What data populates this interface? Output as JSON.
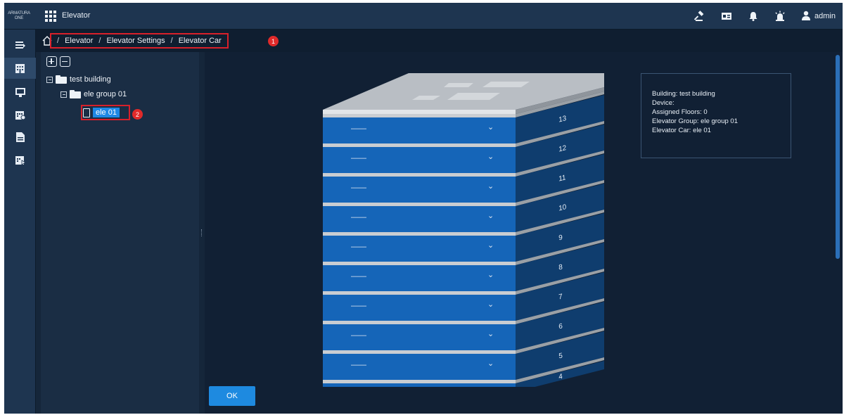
{
  "app": {
    "brand_line1": "ARMATURA",
    "brand_line2": "ONE",
    "title": "Elevator"
  },
  "topbar": {
    "username": "admin",
    "icons": [
      "gavel-icon",
      "id-card-icon",
      "bell-icon",
      "alarm-icon",
      "user-icon"
    ]
  },
  "rail": {
    "items": [
      "list-icon",
      "building-icon",
      "monitor-icon",
      "calendar-icon",
      "file-icon",
      "report-icon"
    ],
    "active_index": 1
  },
  "breadcrumb": {
    "items": [
      "Elevator",
      "Elevator Settings",
      "Elevator Car"
    ],
    "separator": "/",
    "callout": "1"
  },
  "tree": {
    "building": "test building",
    "group": "ele group 01",
    "car": "ele 01",
    "callout": "2"
  },
  "floors": [
    {
      "number": "13",
      "label": "——",
      "chevron": "⌄"
    },
    {
      "number": "12",
      "label": "——",
      "chevron": "⌄"
    },
    {
      "number": "11",
      "label": "——",
      "chevron": "⌄"
    },
    {
      "number": "10",
      "label": "——",
      "chevron": "⌄"
    },
    {
      "number": "9",
      "label": "——",
      "chevron": "⌄"
    },
    {
      "number": "8",
      "label": "——",
      "chevron": "⌄"
    },
    {
      "number": "7",
      "label": "——",
      "chevron": "⌄"
    },
    {
      "number": "6",
      "label": "——",
      "chevron": "⌄"
    },
    {
      "number": "5",
      "label": "——",
      "chevron": "⌄"
    },
    {
      "number": "4",
      "label": "",
      "chevron": ""
    }
  ],
  "info": {
    "building": "Building: test building",
    "device": "Device:",
    "assigned_floors": "Assigned Floors: 0",
    "elevator_group": "Elevator Group: ele group 01",
    "elevator_car": "Elevator Car: ele 01"
  },
  "actions": {
    "ok": "OK"
  },
  "colors": {
    "accent": "#1e8ae0",
    "callout": "#e02a2a",
    "floor_face": "#1565b8",
    "floor_side": "#0f3d6e"
  }
}
